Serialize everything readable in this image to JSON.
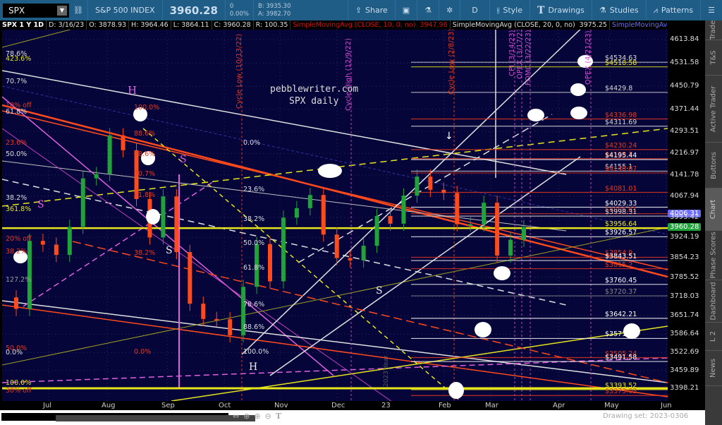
{
  "header": {
    "symbol": "SPX",
    "name": "S&P 500 INDEX",
    "last": "3960.28",
    "change": "0",
    "change_pct": "0.00%",
    "bid": "B: 3935.30",
    "ask": "A: 3982.70",
    "buttons": [
      {
        "label": "Share",
        "icon": "share-icon"
      },
      {
        "label": "",
        "icon": "alert-icon"
      },
      {
        "label": "",
        "icon": "flask-icon"
      },
      {
        "label": "",
        "icon": "gear-icon"
      },
      {
        "label": "D",
        "icon": "aggregation"
      },
      {
        "label": "Style",
        "icon": "candle-style-icon"
      },
      {
        "label": "Drawings",
        "icon": "text-T-icon"
      },
      {
        "label": "Studies",
        "icon": "flask-icon"
      },
      {
        "label": "Patterns",
        "icon": "pattern-icon"
      },
      {
        "label": "",
        "icon": "menu-icon"
      }
    ]
  },
  "legend": {
    "title": "SPX 1 Y 1D",
    "date": "D: 3/16/23",
    "open": "O: 3878.93",
    "high": "H: 3964.46",
    "low": "L: 3864.11",
    "close": "C: 3960.28",
    "range": "R: 100.35",
    "sma10": "SimpleMovingAvg (CLOSE, 10, 0, no)",
    "sma10_val": "3947.96",
    "sma20": "SimpleMovingAvg (CLOSE, 20, 0, no)",
    "sma20_val": "3975.25",
    "sma_more": "SimpleMovingAvg ..."
  },
  "watermark": {
    "line1": "pebblewriter.com",
    "line2": "SPX daily"
  },
  "colors": {
    "bg": "#05053a",
    "up": "#1fa33a",
    "down": "#ff4a1c",
    "fib_red": "#e8381c",
    "yellow": "#e6e61a",
    "magenta": "#e060e0",
    "white": "#e6e6e6"
  },
  "sidebar": [
    "Trade",
    "T&S",
    "Active Trader",
    "Buttons",
    "Chart",
    "Phase Scores",
    "Dashboard",
    "L 2",
    "News"
  ],
  "footer": {
    "drawing_set": "Drawing set: 2023-0306"
  },
  "chart_data": {
    "type": "candlestick",
    "title": "SPX 1 Y 1D",
    "ylim": [
      3370,
      4650
    ],
    "yticks": [
      4613.84,
      4531.58,
      4450.79,
      4371.44,
      4293.51,
      4216.97,
      4141.78,
      4067.94,
      3993.42,
      3924.19,
      3854.23,
      3785.52,
      3718.03,
      3651.74,
      3586.64,
      3522.69,
      3459.89,
      3398.21
    ],
    "xticks": [
      "Jul",
      "Aug",
      "Sep",
      "Oct",
      "Nov",
      "Dec",
      "23",
      "Feb",
      "Mar",
      "Apr",
      "May",
      "Jun"
    ],
    "current_price": "3960.28",
    "sma_badge": "4006.31",
    "weekly_closes": [
      3675,
      3912,
      3899,
      3863,
      3961,
      4130,
      4145,
      4280,
      4228,
      4058,
      3924,
      4067,
      3873,
      3693,
      3640,
      3639,
      3583,
      3752,
      3901,
      3771,
      3993,
      4026,
      4072,
      3934,
      3852,
      3844,
      3895,
      3999,
      3972,
      4070,
      4136,
      4090,
      4079,
      3970,
      3970,
      4045,
      3861,
      3916,
      3960
    ],
    "levels": [
      {
        "label": "$4534.63",
        "price": 4534.63,
        "color": "#d8d8d8"
      },
      {
        "label": "$4518.58",
        "price": 4518.58,
        "color": "#e6e61a"
      },
      {
        "label": "$4429.8",
        "price": 4429.8,
        "color": "#d8d8d8"
      },
      {
        "label": "$4336.98",
        "price": 4336.98,
        "color": "#e8381c"
      },
      {
        "label": "$4311.69",
        "price": 4311.69,
        "color": "#d8d8d8"
      },
      {
        "label": "$4230.24",
        "price": 4230.24,
        "color": "#e8381c"
      },
      {
        "label": "$4198.7",
        "price": 4198.7,
        "color": "#e8381c"
      },
      {
        "label": "$4195.44",
        "price": 4195.44,
        "color": "#ffffff"
      },
      {
        "label": "$4155.1",
        "price": 4155.1,
        "color": "#d8d8d8"
      },
      {
        "label": "$4148.87",
        "price": 4148.87,
        "color": "#e8381c"
      },
      {
        "label": "$4081.01",
        "price": 4081.01,
        "color": "#e8381c"
      },
      {
        "label": "$4029.33",
        "price": 4029.33,
        "color": "#ffffff"
      },
      {
        "label": "$4006.81",
        "price": 4006.81,
        "color": "#e8381c"
      },
      {
        "label": "$3998.31",
        "price": 3998.31,
        "color": "#d8d8d8"
      },
      {
        "label": "$3956.64",
        "price": 3956.64,
        "color": "#e6e61a"
      },
      {
        "label": "$3926.57",
        "price": 3926.57,
        "color": "#ffffff"
      },
      {
        "label": "$3854.9",
        "price": 3854.9,
        "color": "#e8381c"
      },
      {
        "label": "$3843.51",
        "price": 3843.51,
        "color": "#ffffff"
      },
      {
        "label": "$3815.2",
        "price": 3815.2,
        "color": "#e8381c"
      },
      {
        "label": "$3760.45",
        "price": 3760.45,
        "color": "#ffffff"
      },
      {
        "label": "$3720.37",
        "price": 3720.37,
        "color": "#888888"
      },
      {
        "label": "$3642.21",
        "price": 3642.21,
        "color": "#ffffff"
      },
      {
        "label": "$3571.82",
        "price": 3571.82,
        "color": "#ffffff"
      },
      {
        "label": "$3505.24",
        "price": 3505.24,
        "color": "#e8381c"
      },
      {
        "label": "$3491.58",
        "price": 3491.58,
        "color": "#ffffff"
      },
      {
        "label": "$3393.52",
        "price": 3393.52,
        "color": "#e6e61a"
      },
      {
        "label": "$3373.03",
        "price": 3373.03,
        "color": "#e8381c"
      }
    ],
    "fib_labels": {
      "l1": "78.6%",
      "l2": "423.6%",
      "l3": "70.7%",
      "l4": "10% off",
      "l5": "61.8%",
      "l6": "23.6%",
      "l7": "50.0%",
      "l8": "38.2%",
      "l9": "361.8%",
      "l10": "20% off",
      "l11": "38.2%",
      "l12": "127.2%",
      "l13": "50.0%",
      "l14": "0.0%",
      "l15": "100.0%",
      "l16": "30% off",
      "m1": "100.0%",
      "m2": "88.6%",
      "m3": "78.6%",
      "m4": "70.7%",
      "m5": "61.8%",
      "m6": "38.2%",
      "m7": "0.0%",
      "c1": "0.0%",
      "c2": "23.6%",
      "c3": "38.2%",
      "c4": "50.0%",
      "c5": "61.8%",
      "c6": "78.6%",
      "c7": "88.6%",
      "c8": "100.0%"
    },
    "pattern_labels": {
      "h1": "H",
      "s1": "S",
      "s2": "S",
      "s3": "S",
      "h2": "H",
      "s4": "S"
    },
    "events": {
      "e1": "Cycle Low (10/13/22)",
      "e2": "Cycle High (12/9/22)",
      "e3": "Cycle Low (2/8/23)",
      "e4": "CPI (3/14/23)",
      "e5": "OPEX (3/17/23)",
      "e6": "FOMC (3/22/23)",
      "e7": "OPEX (4/21/23)",
      "e8": "2023 Year"
    }
  }
}
